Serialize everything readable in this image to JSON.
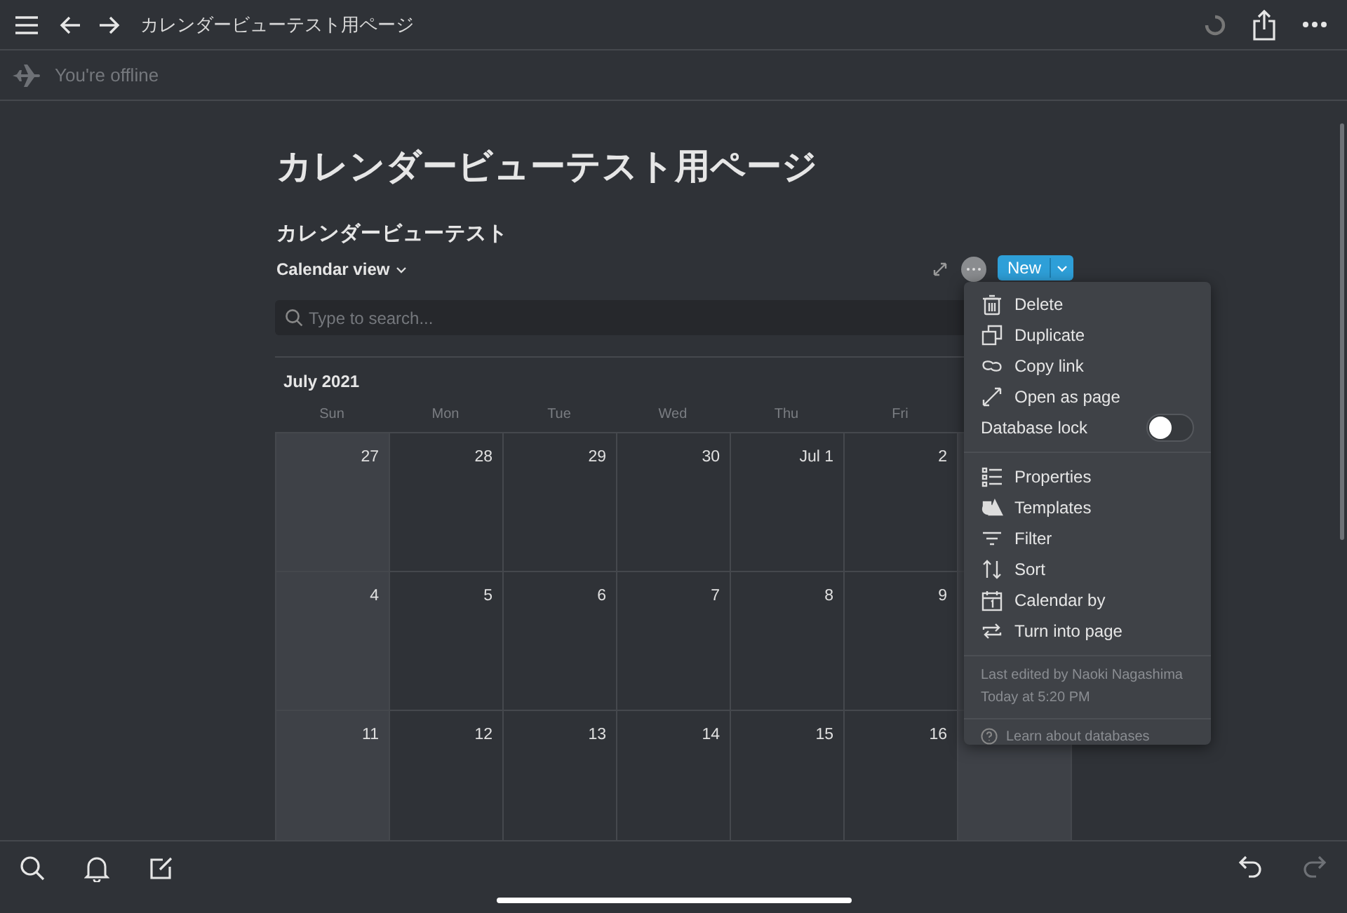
{
  "top_bar": {
    "title": "カレンダービューテスト用ページ"
  },
  "offline_bar": {
    "text": "You're offline"
  },
  "page": {
    "title": "カレンダービューテスト用ページ",
    "database_title": "カレンダービューテスト",
    "view_name": "Calendar view",
    "new_button": "New",
    "search": {
      "placeholder": "Type to search..."
    }
  },
  "calendar": {
    "month": "July 2021",
    "weekdays": [
      "Sun",
      "Mon",
      "Tue",
      "Wed",
      "Thu",
      "Fri"
    ],
    "weeks": [
      [
        {
          "day": "27",
          "kind": "weekend"
        },
        {
          "day": "28",
          "kind": "weekday"
        },
        {
          "day": "29",
          "kind": "weekday"
        },
        {
          "day": "30",
          "kind": "weekday"
        },
        {
          "day": "Jul 1",
          "kind": "weekday"
        },
        {
          "day": "2",
          "kind": "weekday"
        },
        {
          "kind": "weekend"
        }
      ],
      [
        {
          "day": "4",
          "kind": "weekend"
        },
        {
          "day": "5",
          "kind": "weekday"
        },
        {
          "day": "6",
          "kind": "weekday"
        },
        {
          "day": "7",
          "kind": "weekday"
        },
        {
          "day": "8",
          "kind": "weekday"
        },
        {
          "day": "9",
          "kind": "weekday"
        },
        {
          "kind": "weekend"
        }
      ],
      [
        {
          "day": "11",
          "kind": "weekend"
        },
        {
          "day": "12",
          "kind": "weekday"
        },
        {
          "day": "13",
          "kind": "weekday"
        },
        {
          "day": "14",
          "kind": "weekday"
        },
        {
          "day": "15",
          "kind": "weekday"
        },
        {
          "day": "16",
          "kind": "weekday"
        },
        {
          "kind": "weekend"
        }
      ]
    ]
  },
  "menu": {
    "groups": [
      [
        {
          "kind": "action",
          "label": "Delete"
        },
        {
          "kind": "action",
          "label": "Duplicate"
        },
        {
          "kind": "action",
          "label": "Copy link"
        },
        {
          "kind": "action",
          "label": "Open as page"
        },
        {
          "kind": "toggle",
          "label": "Database lock",
          "on": false
        }
      ],
      [
        {
          "kind": "action",
          "label": "Properties"
        },
        {
          "kind": "action",
          "label": "Templates"
        },
        {
          "kind": "action",
          "label": "Filter"
        },
        {
          "kind": "action",
          "label": "Sort"
        },
        {
          "kind": "action",
          "label": "Calendar by"
        },
        {
          "kind": "action",
          "label": "Turn into page"
        }
      ]
    ],
    "last_edited": "Last edited by Naoki Nagashima",
    "edited_time": "Today at 5:20 PM",
    "help_link": "Learn about databases"
  },
  "bottom_bar": {
    "undo": {
      "disabled": false
    },
    "redo": {
      "disabled": true
    }
  }
}
